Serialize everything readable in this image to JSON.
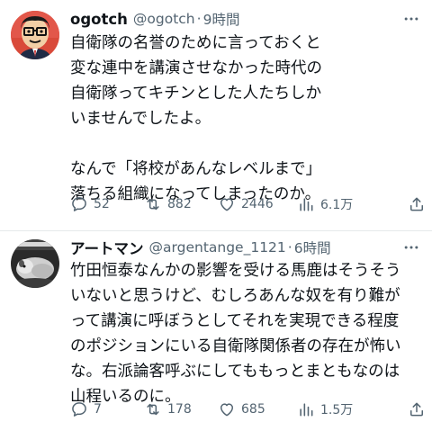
{
  "tweets": [
    {
      "display_name": "ogotch",
      "handle": "@ogotch",
      "separator": "·",
      "time": "9時間",
      "lines": [
        "自衛隊の名誉のために言っておくと",
        "変な連中を講演させなかった時代の",
        "自衛隊ってキチンとした人たちしか",
        "いませんでしたよ。",
        "",
        "なんで「将校があんなレベルまで」",
        "落ちる組織になってしまったのか。"
      ],
      "replies": "52",
      "retweets": "882",
      "likes": "2446",
      "views": "6.1万"
    },
    {
      "display_name": "アートマン",
      "handle": "@argentange_1121",
      "separator": "·",
      "time": "6時間",
      "lines": [
        "竹田恒泰なんかの影響を受ける馬鹿はそうそう",
        "いないと思うけど、むしろあんな奴を有り難が",
        "って講演に呼ぼうとしてそれを実現できる程度",
        "のポジションにいる自衛隊関係者の存在が怖い",
        "な。右派論客呼ぶにしてももっとまともなのは",
        "山程いるのに。"
      ],
      "replies": "7",
      "retweets": "178",
      "likes": "685",
      "views": "1.5万"
    }
  ],
  "icons": {
    "more": "more-icon",
    "reply": "reply-icon",
    "retweet": "retweet-icon",
    "like": "like-icon",
    "views": "views-icon",
    "share": "share-icon"
  },
  "colors": {
    "text": "#0f1419",
    "secondary": "#536471",
    "divider": "#e6e9eb"
  }
}
